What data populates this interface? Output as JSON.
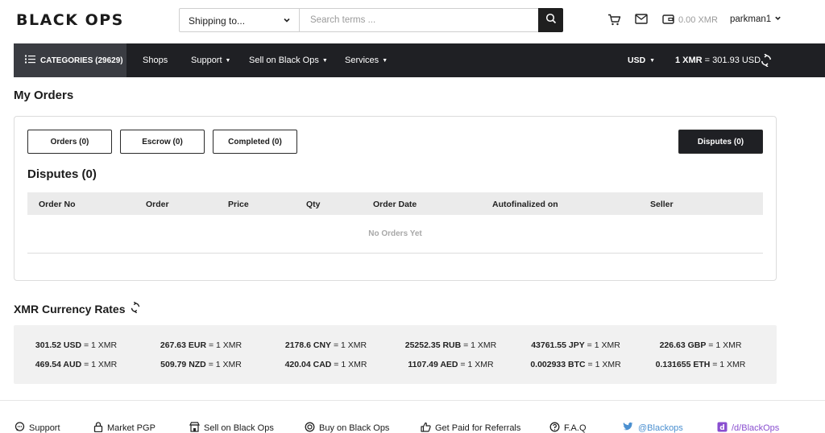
{
  "header": {
    "logo": "BLACK OPS",
    "shipping_label": "Shipping to...",
    "search_placeholder": "Search terms ...",
    "balance": "0.00 XMR",
    "username": "parkman1"
  },
  "nav": {
    "categories": "CATEGORIES (29629)",
    "items": [
      {
        "label": "Shops"
      },
      {
        "label": "Support"
      },
      {
        "label": "Sell on Black Ops"
      },
      {
        "label": "Services"
      }
    ],
    "currency": "USD",
    "rate_bold": "1 XMR",
    "rate_rest": " = 301.93 USD"
  },
  "page": {
    "title": "My Orders",
    "tabs": [
      {
        "label": "Orders (0)"
      },
      {
        "label": "Escrow (0)"
      },
      {
        "label": "Completed (0)"
      },
      {
        "label": "Disputes (0)"
      }
    ],
    "section_title": "Disputes (0)",
    "columns": [
      "Order No",
      "Order",
      "Price",
      "Qty",
      "Order Date",
      "Autofinalized on",
      "Seller"
    ],
    "empty_text": "No Orders Yet"
  },
  "rates": {
    "title": "XMR Currency Rates",
    "row1": [
      {
        "amount": "301.52 USD",
        "suffix": " = 1 XMR"
      },
      {
        "amount": "267.63 EUR",
        "suffix": " = 1 XMR"
      },
      {
        "amount": "2178.6 CNY",
        "suffix": " = 1 XMR"
      },
      {
        "amount": "25252.35 RUB",
        "suffix": " = 1 XMR"
      },
      {
        "amount": "43761.55 JPY",
        "suffix": " = 1 XMR"
      },
      {
        "amount": "226.63 GBP",
        "suffix": " = 1 XMR"
      }
    ],
    "row2": [
      {
        "amount": "469.54 AUD",
        "suffix": " = 1 XMR"
      },
      {
        "amount": "509.79 NZD",
        "suffix": " = 1 XMR"
      },
      {
        "amount": "420.04 CAD",
        "suffix": " = 1 XMR"
      },
      {
        "amount": "1107.49 AED",
        "suffix": " = 1 XMR"
      },
      {
        "amount": "0.002933 BTC",
        "suffix": " = 1 XMR"
      },
      {
        "amount": "0.131655 ETH",
        "suffix": " = 1 XMR"
      }
    ]
  },
  "footer": {
    "items": [
      {
        "label": "Support"
      },
      {
        "label": "Market PGP"
      },
      {
        "label": "Sell on Black Ops"
      },
      {
        "label": "Buy on Black Ops"
      },
      {
        "label": "Get Paid for Referrals"
      },
      {
        "label": "F.A.Q"
      },
      {
        "label": "@Blackops"
      },
      {
        "label": "/d/BlackOps"
      }
    ]
  },
  "colors": {
    "navbar": "#1f2024",
    "category_button": "#3a3c42",
    "active_tab": "#1f2024",
    "table_header": "#ebebeb",
    "rates_background": "#f1f1f1",
    "link_blue": "#4a8fd0",
    "link_purple": "#8a4fd0"
  }
}
